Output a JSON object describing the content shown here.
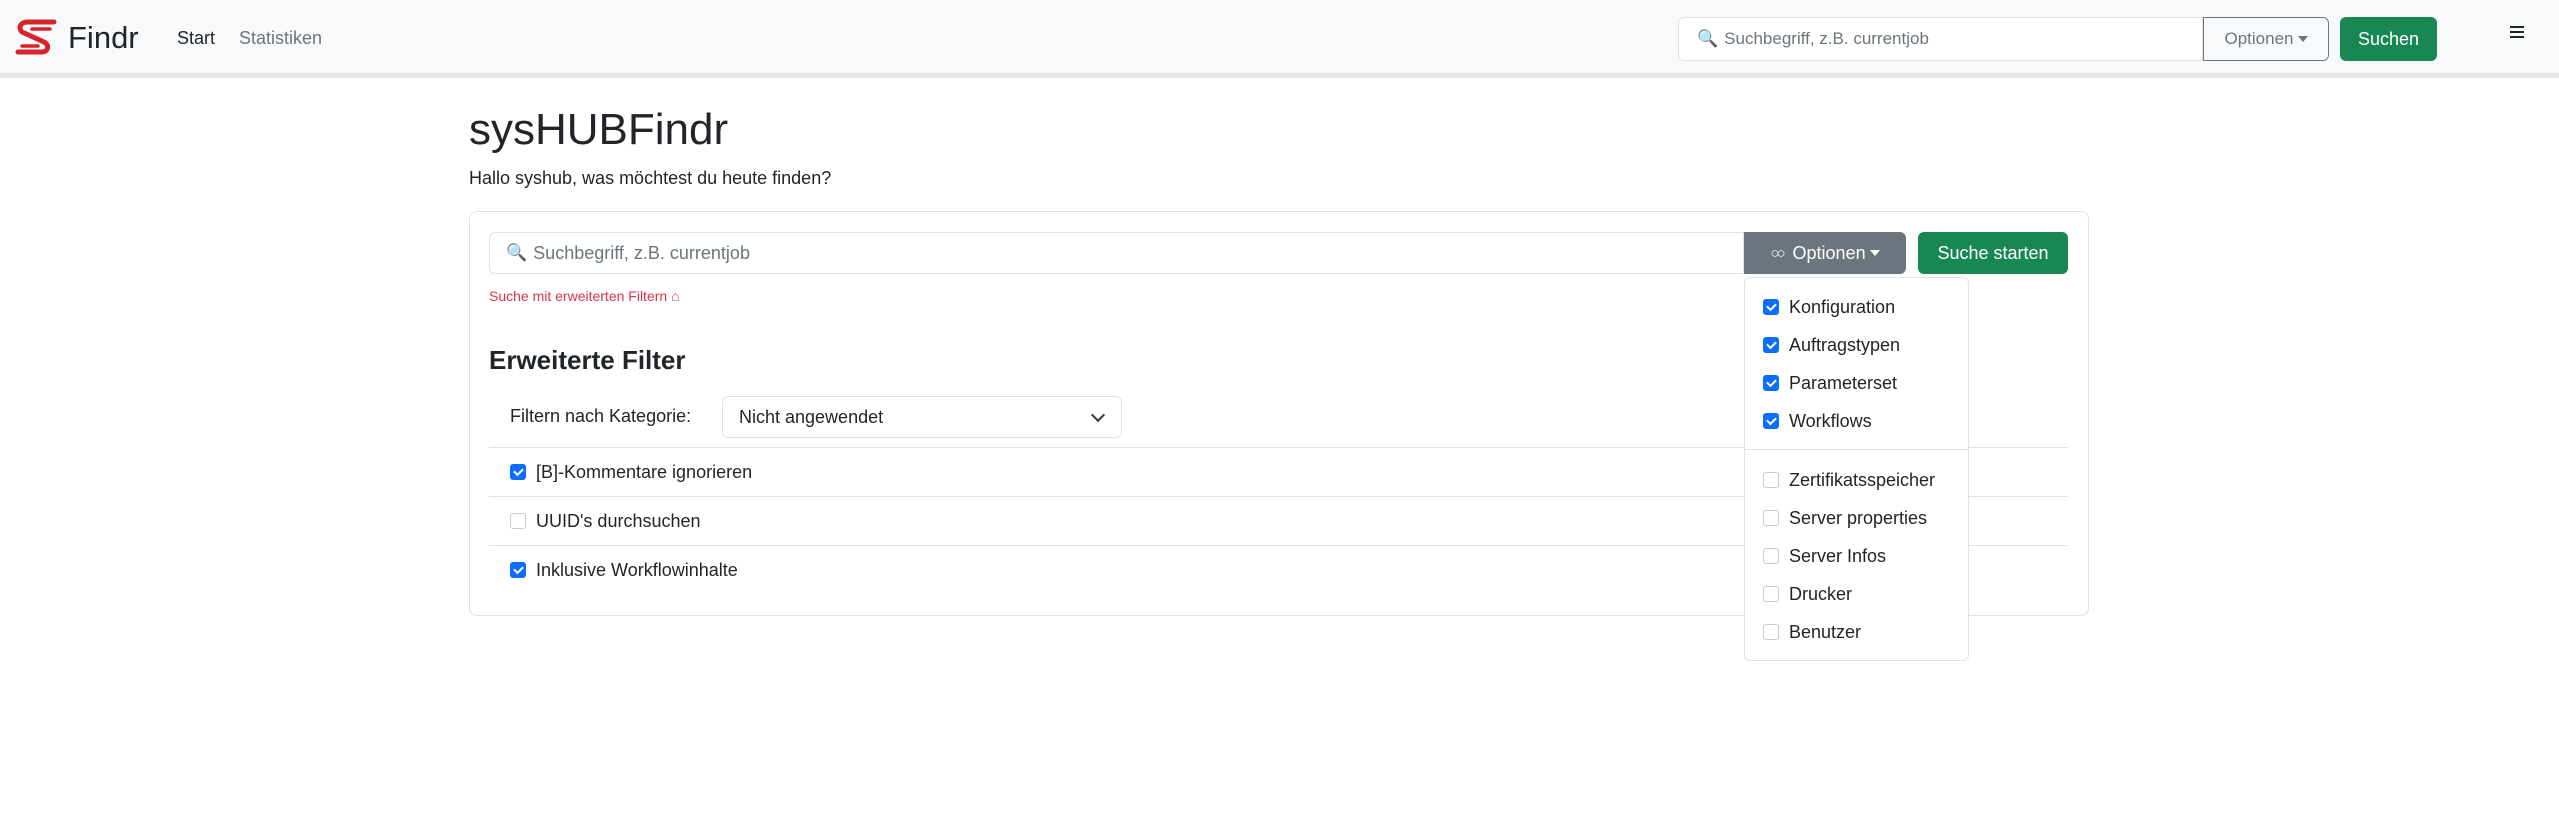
{
  "navbar": {
    "brand": "Findr",
    "links": [
      "Start",
      "Statistiken"
    ],
    "search_placeholder": "Suchbegriff, z.B. currentjob",
    "options_label": "Optionen",
    "search_button": "Suchen"
  },
  "page": {
    "title": "sysHUBFindr",
    "subtitle": "Hallo syshub, was möchtest du heute finden?"
  },
  "search": {
    "placeholder": "Suchbegriff, z.B. currentjob",
    "options_label": "Optionen",
    "submit_label": "Suche starten",
    "advanced_link": "Suche mit erweiterten Filtern ⌂"
  },
  "filters": {
    "heading": "Erweiterte Filter",
    "category_label": "Filtern nach Kategorie:",
    "category_value": "Nicht angewendet",
    "options": [
      {
        "label": "[B]-Kommentare ignorieren",
        "checked": true
      },
      {
        "label": "UUID's durchsuchen",
        "checked": false
      },
      {
        "label": "Inklusive Workflowinhalte",
        "checked": true
      }
    ]
  },
  "dropdown": {
    "items": [
      {
        "label": "Konfiguration",
        "checked": true
      },
      {
        "label": "Auftragstypen",
        "checked": true
      },
      {
        "label": "Parameterset",
        "checked": true
      },
      {
        "label": "Workflows",
        "checked": true
      },
      {
        "label": "Zertifikatsspeicher",
        "checked": false
      },
      {
        "label": "Server properties",
        "checked": false
      },
      {
        "label": "Server Infos",
        "checked": false
      },
      {
        "label": "Drucker",
        "checked": false
      },
      {
        "label": "Benutzer",
        "checked": false
      }
    ]
  },
  "colors": {
    "accent_green": "#198754",
    "checkbox_blue": "#0d6efd",
    "secondary_gray": "#6c757d",
    "link_red": "#dc3545"
  }
}
